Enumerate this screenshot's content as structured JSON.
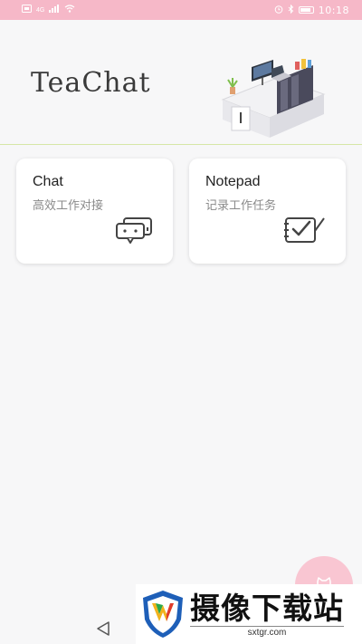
{
  "status_bar": {
    "time": "10:18",
    "network": "4G",
    "icons": [
      "sim-icon",
      "signal-icon",
      "wifi-icon",
      "alarm-icon",
      "bluetooth-icon",
      "battery-icon"
    ]
  },
  "header": {
    "title": "TeaChat",
    "illustration": "desk-workspace-illustration"
  },
  "cards": [
    {
      "title": "Chat",
      "description": "高效工作对接",
      "icon": "chat-bubbles-icon"
    },
    {
      "title": "Notepad",
      "description": "记录工作任务",
      "icon": "notepad-icon"
    }
  ],
  "fab": {
    "icon": "cat-icon"
  },
  "nav": {
    "back_icon": "back-triangle-icon"
  },
  "watermark": {
    "title": "摄像下载站",
    "url": "sxtgr.com"
  },
  "colors": {
    "status_bar": "#f6b8c8",
    "background": "#f7f7f8",
    "divider": "#d6e6a7",
    "fab": "#f9c6d2"
  }
}
